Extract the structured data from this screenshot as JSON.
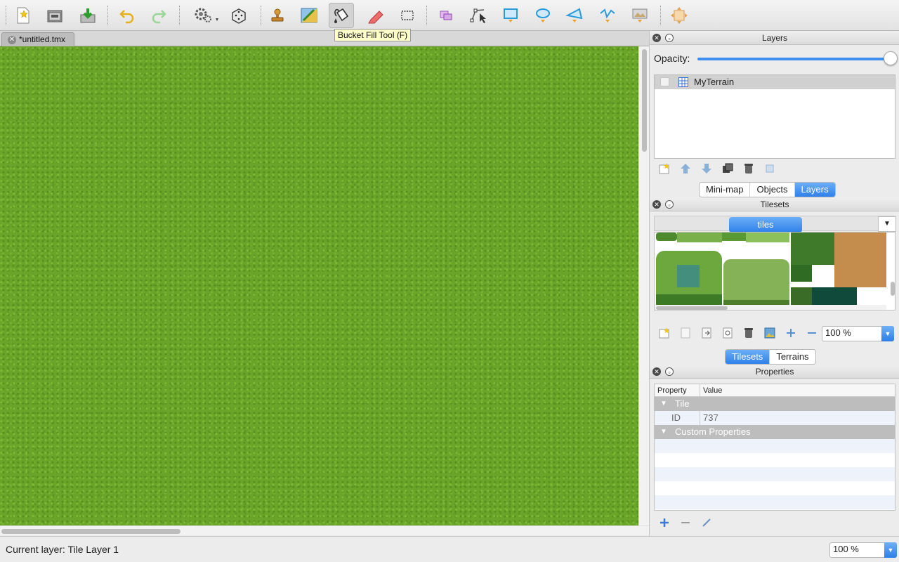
{
  "toolbar": {
    "tooltip": "Bucket Fill Tool (F)",
    "tools": [
      "new-file-icon",
      "open-file-icon",
      "save-file-icon",
      "undo-icon",
      "redo-icon",
      "random-mode-icon",
      "dice-icon",
      "stamp-brush-icon",
      "terrain-brush-icon",
      "bucket-fill-icon",
      "eraser-icon",
      "rectangle-select-icon",
      "select-objects-icon",
      "edit-polygons-icon",
      "insert-rectangle-icon",
      "insert-ellipse-icon",
      "insert-polygon-icon",
      "insert-polyline-icon",
      "insert-tile-icon",
      "layer-offset-icon"
    ]
  },
  "document": {
    "tab_label": "*untitled.tmx"
  },
  "status": {
    "current_layer": "Current layer: Tile Layer 1",
    "zoom": "100 %"
  },
  "layers_panel": {
    "title": "Layers",
    "opacity_label": "Opacity:",
    "layers": [
      {
        "name": "MyTerrain",
        "visible": false
      }
    ]
  },
  "panel_tabs_top": {
    "minimap": "Mini-map",
    "objects": "Objects",
    "layers": "Layers",
    "active": "Layers"
  },
  "tilesets_panel": {
    "title": "Tilesets",
    "tileset_name": "tiles",
    "zoom": "100 %"
  },
  "panel_tabs_mid": {
    "tilesets": "Tilesets",
    "terrains": "Terrains",
    "active": "Tilesets"
  },
  "properties_panel": {
    "title": "Properties",
    "col_property": "Property",
    "col_value": "Value",
    "group_tile": "Tile",
    "id_label": "ID",
    "id_value": "737",
    "group_custom": "Custom Properties"
  },
  "colors": {
    "accent": "#3d8ef0",
    "grass": "#6aa52a",
    "tooltip_bg": "#ffffca"
  }
}
